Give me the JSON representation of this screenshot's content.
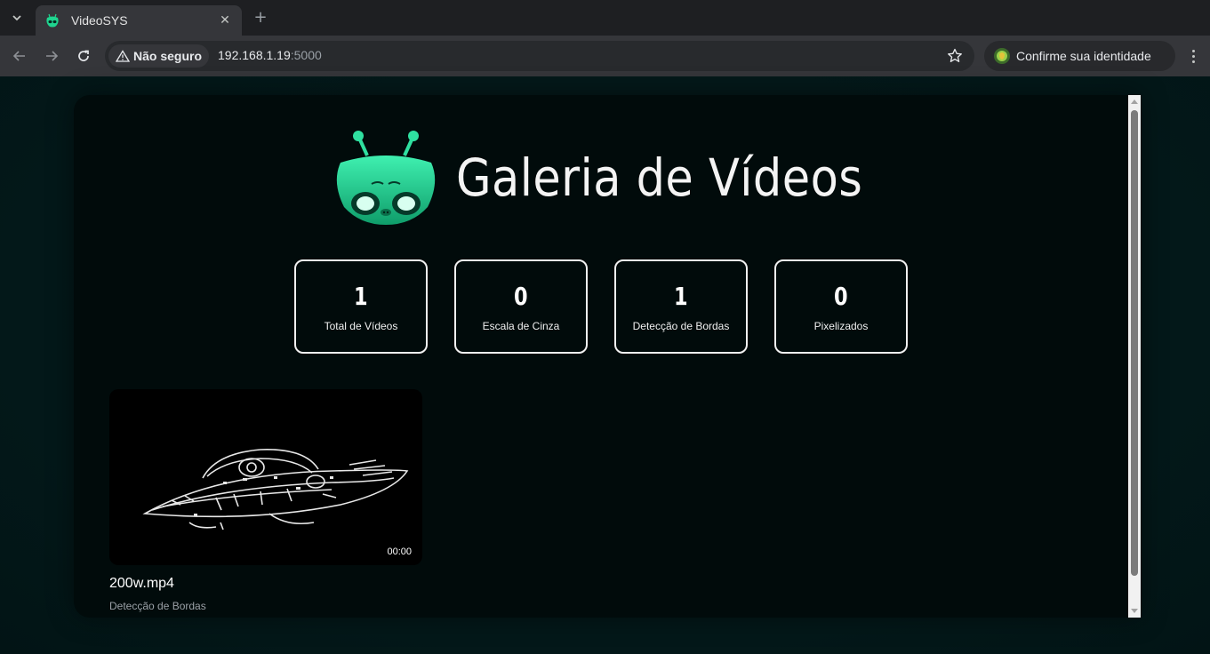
{
  "browser": {
    "tab_title": "VideoSYS",
    "tab_close_icon": "close-icon",
    "new_tab_icon": "plus-icon",
    "security_label": "Não seguro",
    "url_host": "192.168.1.19",
    "url_port": ":5000",
    "profile_label": "Confirme sua identidade"
  },
  "page": {
    "title": "Galeria de Vídeos",
    "logo_icon": "alien-icon",
    "accent_color": "#1fd58f"
  },
  "stats": [
    {
      "value": "1",
      "label": "Total de Vídeos"
    },
    {
      "value": "0",
      "label": "Escala de Cinza"
    },
    {
      "value": "1",
      "label": "Detecção de Bordas"
    },
    {
      "value": "0",
      "label": "Pixelizados"
    }
  ],
  "videos": [
    {
      "duration": "00:00",
      "name": "200w.mp4",
      "filter": "Detecção de Bordas"
    }
  ]
}
